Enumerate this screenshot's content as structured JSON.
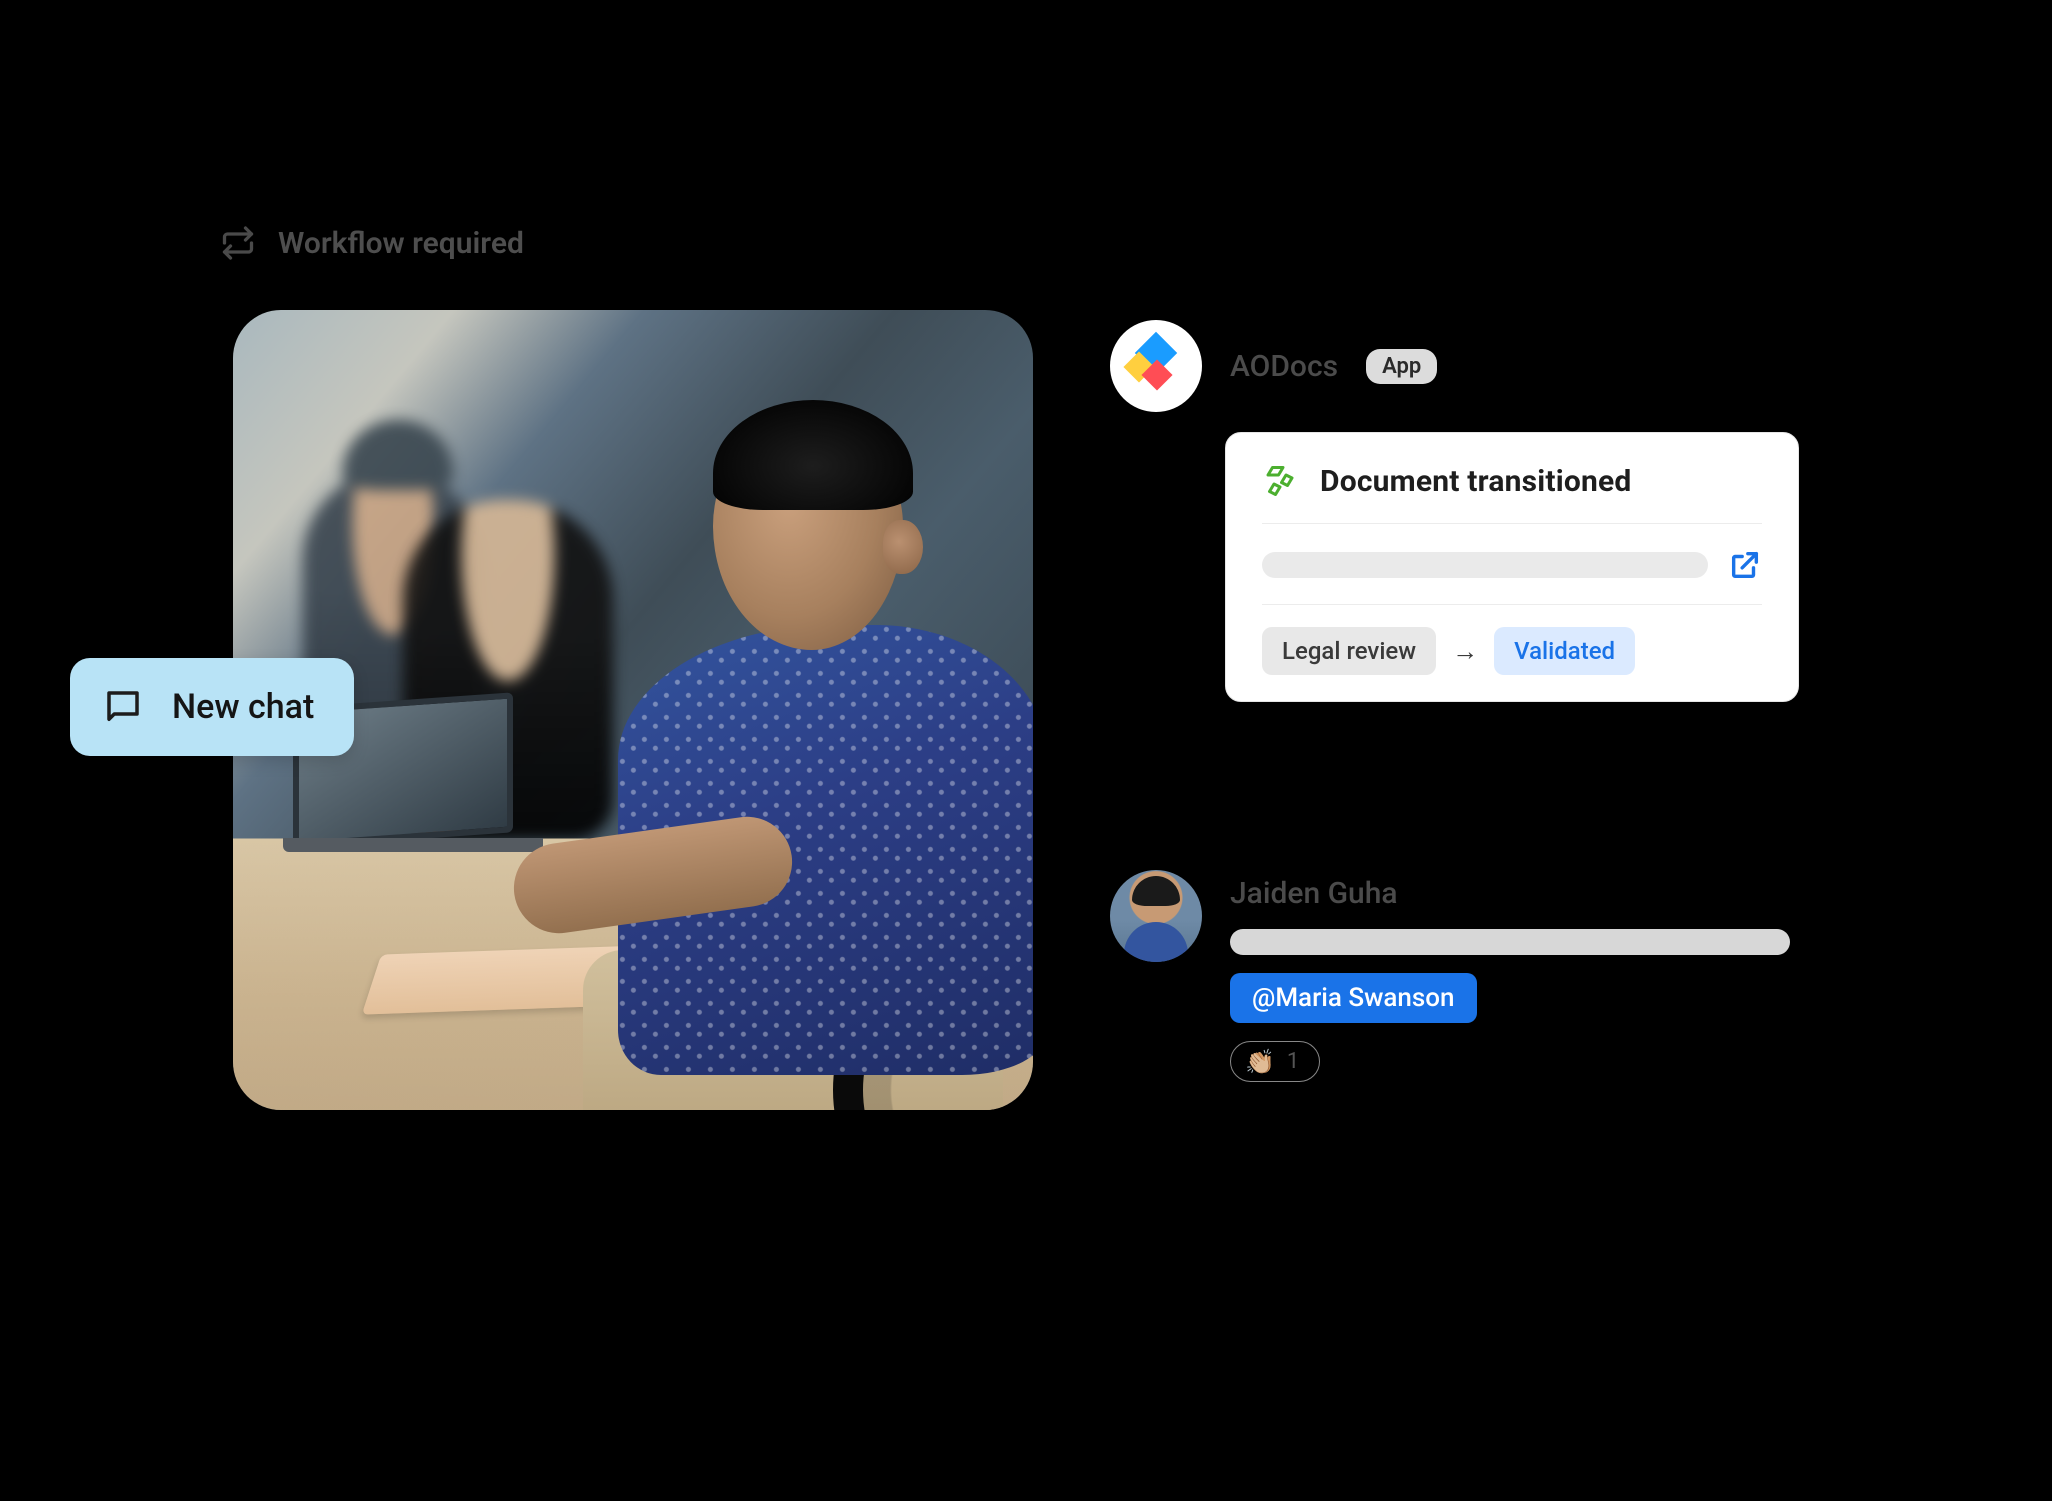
{
  "header": {
    "workflow_label": "Workflow required"
  },
  "new_chat": {
    "label": "New chat"
  },
  "aodocs": {
    "name": "AODocs",
    "badge": "App"
  },
  "card": {
    "title": "Document transitioned",
    "from_state": "Legal review",
    "to_state": "Validated",
    "arrow": "→"
  },
  "message": {
    "author": "Jaiden Guha",
    "mention": "@Maria Swanson",
    "reaction_emoji": "👏🏼",
    "reaction_count": "1"
  }
}
